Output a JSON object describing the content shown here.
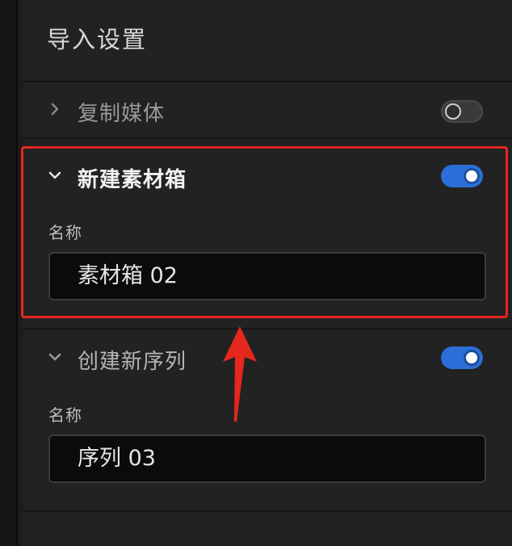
{
  "panel": {
    "title": "导入设置"
  },
  "sections": [
    {
      "label": "复制媒体",
      "expanded": false,
      "enabled": false
    },
    {
      "label": "新建素材箱",
      "expanded": true,
      "enabled": true,
      "field_label": "名称",
      "field_value": "素材箱 02"
    },
    {
      "label": "创建新序列",
      "expanded": true,
      "enabled": true,
      "field_label": "名称",
      "field_value": "序列 03"
    }
  ],
  "colors": {
    "accent": "#2c6fd8",
    "highlight": "#e5271e",
    "panel_bg": "#222222"
  },
  "icons": {
    "collapsed": "chevron-right-icon",
    "expanded": "chevron-down-icon"
  }
}
